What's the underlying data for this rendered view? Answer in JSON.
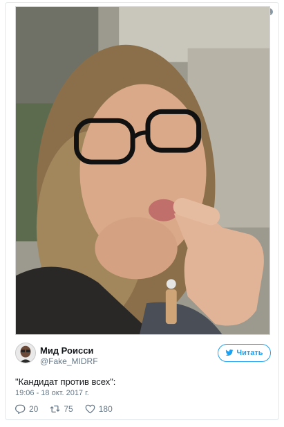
{
  "tweet": {
    "author_name": "Мид Роисси",
    "author_handle": "@Fake_MIDRF",
    "follow_label": "Читать",
    "text": "\"Кандидат против всех\":",
    "timestamp": "19:06 - 18 окт. 2017 г.",
    "replies": "20",
    "retweets": "75",
    "likes": "180"
  },
  "icons": {
    "info": "info-icon",
    "follow": "twitter-bird-icon",
    "reply": "reply-icon",
    "retweet": "retweet-icon",
    "like": "heart-icon"
  },
  "colors": {
    "accent": "#1da1f2",
    "secondary_text": "#657786",
    "border": "#e1e8ed"
  }
}
